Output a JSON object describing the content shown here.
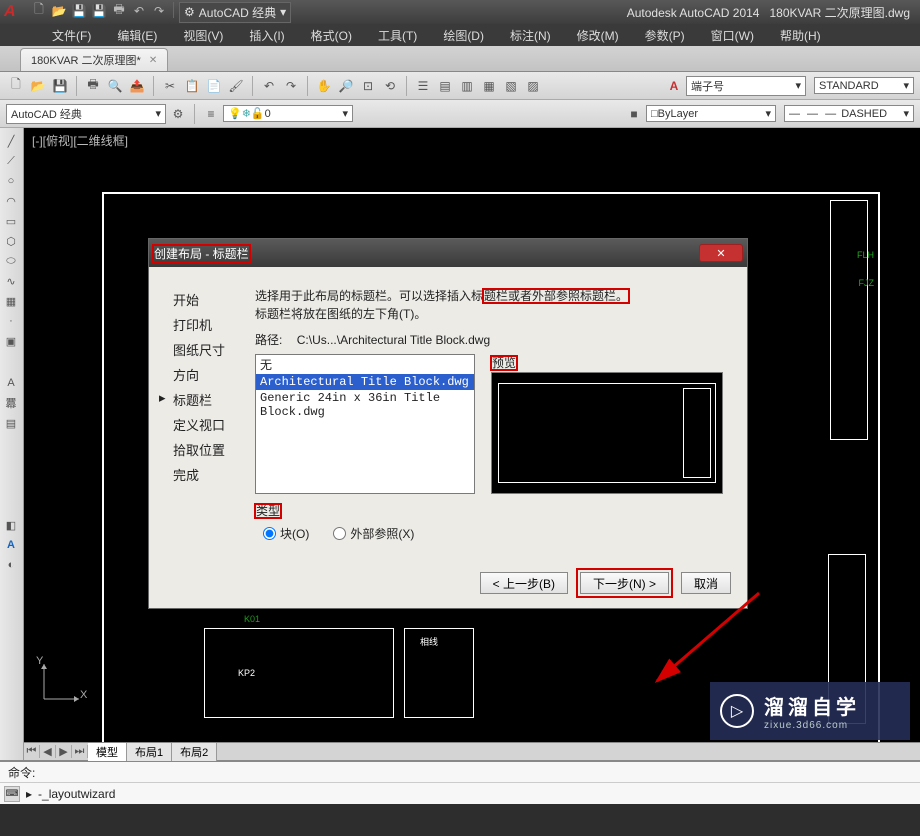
{
  "title": {
    "app": "Autodesk AutoCAD 2014",
    "file": "180KVAR 二次原理图.dwg"
  },
  "qat_workspace": "AutoCAD 经典",
  "menu": [
    "文件(F)",
    "编辑(E)",
    "视图(V)",
    "插入(I)",
    "格式(O)",
    "工具(T)",
    "绘图(D)",
    "标注(N)",
    "修改(M)",
    "参数(P)",
    "窗口(W)",
    "帮助(H)"
  ],
  "doc_tab": {
    "label": "180KVAR 二次原理图*",
    "dirty": true
  },
  "toolbar2": {
    "workspace_combo": "AutoCAD 经典",
    "layer_state": "0",
    "bylayer": "ByLayer",
    "style_label": "端子号",
    "standard": "STANDARD",
    "linetype": "DASHED"
  },
  "viewport_label": "[-][俯视][二维线框]",
  "dialog": {
    "title": "创建布局 - 标题栏",
    "nav": [
      "开始",
      "打印机",
      "图纸尺寸",
      "方向",
      "标题栏",
      "定义视口",
      "拾取位置",
      "完成"
    ],
    "nav_active_index": 4,
    "prompt1_a": "选择用于此布局的标题栏。可以选择插入标",
    "prompt1_b": "题栏或者外部参照标题栏。",
    "prompt2": "标题栏将放在图纸的左下角(T)。",
    "path_label": "路径:",
    "path_value": "C:\\Us...\\Architectural Title Block.dwg",
    "files": [
      "无",
      "Architectural Title Block.dwg",
      "Generic 24in x 36in Title Block.dwg"
    ],
    "file_selected_index": 1,
    "preview_label": "预览",
    "type_label": "类型",
    "radio_block": "块(O)",
    "radio_xref": "外部参照(X)",
    "btn_back": "< 上一步(B)",
    "btn_next": "下一步(N) >",
    "btn_cancel": "取消"
  },
  "layout_tabs": [
    "模型",
    "布局1",
    "布局2"
  ],
  "cmd": {
    "history": "命令:",
    "input": "-_layoutwizard"
  },
  "ucs": {
    "x": "X",
    "y": "Y"
  },
  "watermark": {
    "brand": "溜溜自学",
    "url": "zixue.3d66.com"
  },
  "drawing_labels": {
    "flh": "FLH",
    "fjz": "FJZ",
    "kp2": "KP2",
    "k01": "K01",
    "phase": "相线"
  }
}
